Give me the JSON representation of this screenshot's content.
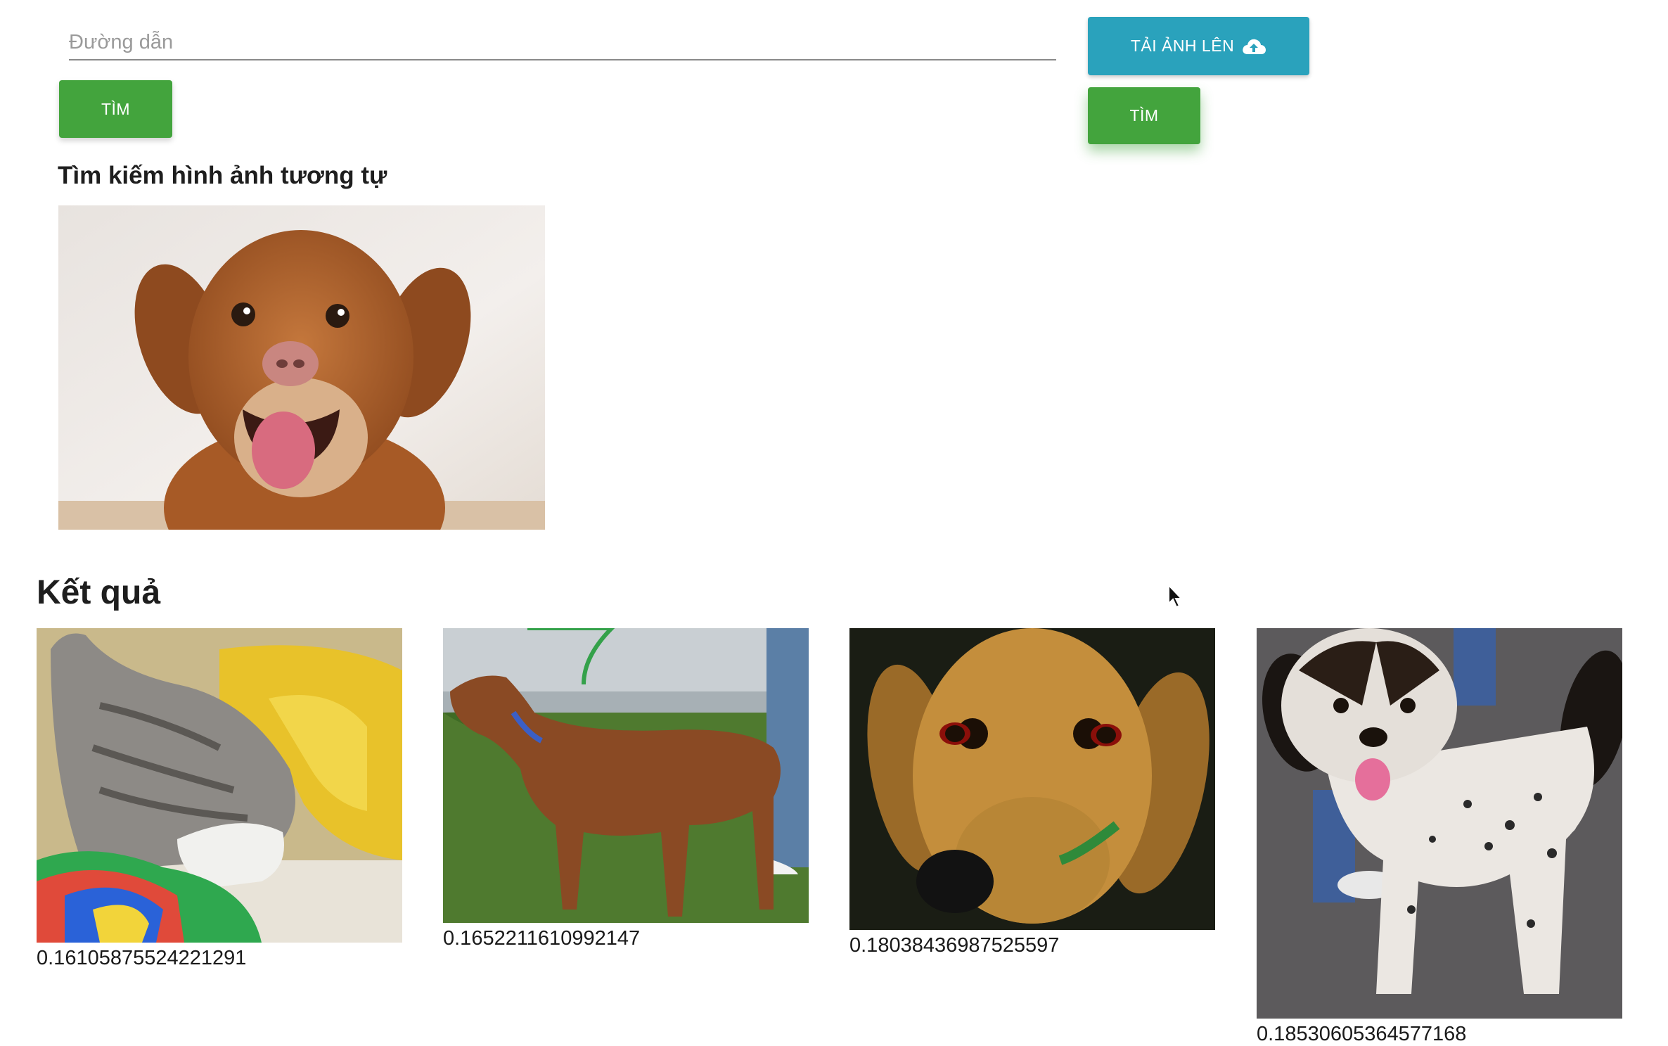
{
  "search": {
    "placeholder": "Đường dẫn",
    "value": ""
  },
  "buttons": {
    "find_left": "TÌM",
    "upload": "TẢI ẢNH LÊN",
    "upload_icon": "cloud-upload-icon",
    "find_right": "TÌM"
  },
  "query": {
    "heading": "Tìm kiếm hình ảnh tương tự",
    "image_alt": "smiling orange retriever dog"
  },
  "results": {
    "heading": "Kết quả",
    "items": [
      {
        "score": "0.16105875524221291",
        "image": "grey and white cat on colorful blanket"
      },
      {
        "score": "0.1652211610992147",
        "image": "brown dog on leash on grass"
      },
      {
        "score": "0.18038436987525597",
        "image": "close-up of tan hound face"
      },
      {
        "score": "0.18530605364577168",
        "image": "spotted black and white dog on pavement"
      }
    ]
  },
  "colors": {
    "green_button": "#43a43d",
    "blue_button": "#2aa2bc",
    "input_underline": "#8a8a8a"
  }
}
